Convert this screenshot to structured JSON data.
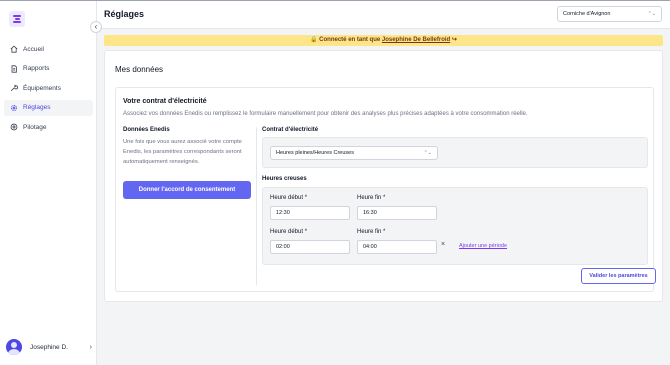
{
  "app": {
    "page_title": "Réglages"
  },
  "header": {
    "site_select_value": "Corniche d'Avignon",
    "updown_glyph": "⌃⌄"
  },
  "sidebar": {
    "items": [
      {
        "label": "Accueil",
        "icon": "home-icon"
      },
      {
        "label": "Rapports",
        "icon": "document-icon"
      },
      {
        "label": "Équipements",
        "icon": "wrench-icon"
      },
      {
        "label": "Réglages",
        "icon": "gear-icon",
        "active": true
      },
      {
        "label": "Pilotage",
        "icon": "power-icon"
      }
    ],
    "collapse_glyph": "‹",
    "user": {
      "name": "Josephine D.",
      "chevron": "›"
    }
  },
  "banner": {
    "prefix": "🔒 Connecté en tant que",
    "user_link": "Josephine De Bellefroid",
    "exit_icon": "↪",
    "color": "#fde68a"
  },
  "main": {
    "title": "Mes données",
    "contract_card": {
      "title": "Votre contrat d'électricité",
      "description": "Associez vos données Enedis ou remplissez le formulaire manuellement pour obtenir des analyses plus précises adaptées à votre consommation réelle.",
      "enedis": {
        "title": "Données Enedis",
        "text": "Une fois que vous aurez associé votre compte Enedis, les paramètres correspondants seront automatiquement renseignés.",
        "button": "Donner l'accord de consentement"
      },
      "contract": {
        "title": "Contrat d'électricité",
        "select_value": "Heures pleines/Heures Creuses"
      },
      "off_peak": {
        "title": "Heures creuses",
        "start_label": "Heure début *",
        "end_label": "Heure fin *",
        "periods": [
          {
            "start": "12:30",
            "end": "16:30"
          },
          {
            "start": "02:00",
            "end": "04:00"
          }
        ],
        "remove_glyph": "×",
        "add_link": "Ajouter une période"
      },
      "validate_button": "Valider les paramètres"
    }
  },
  "colors": {
    "accent": "#6366f1",
    "accent_dark": "#4f46e5",
    "link": "#7c3aed"
  }
}
